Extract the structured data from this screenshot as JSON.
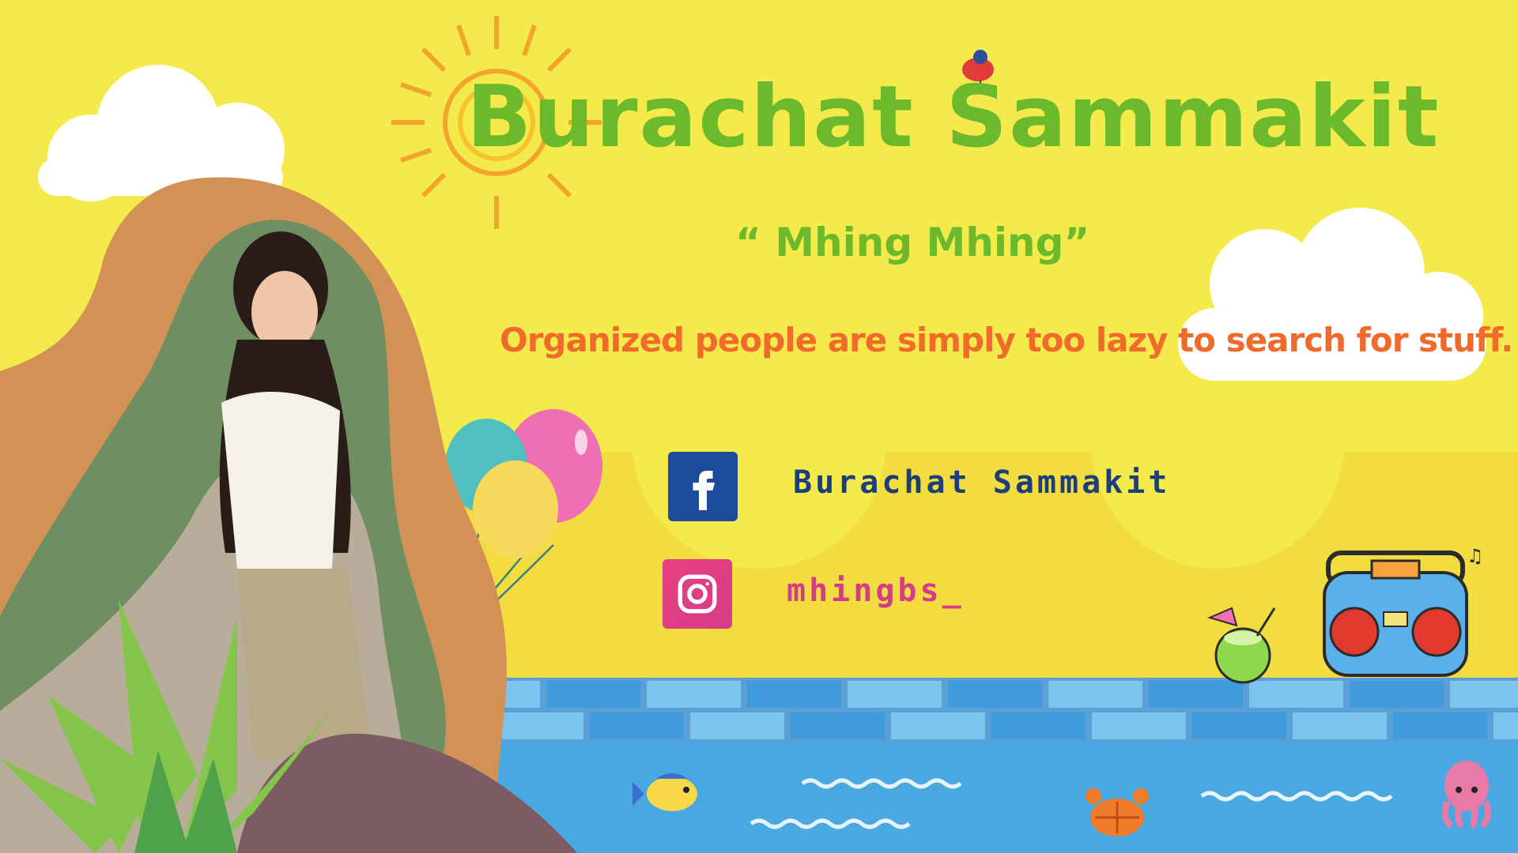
{
  "profile": {
    "name": "Burachat Sammakit",
    "nickname": "“ Mhing Mhing”",
    "tagline": "Organized people are simply too lazy to search for stuff."
  },
  "social": {
    "facebook": {
      "icon": "facebook-icon",
      "handle": "Burachat Sammakit"
    },
    "instagram": {
      "icon": "instagram-icon",
      "handle": "mhingbs_"
    }
  },
  "colors": {
    "background": "#f5ea4c",
    "title": "#6cba2c",
    "tagline": "#ef6a2b",
    "facebook": "#1c4b9c",
    "instagram": "#d63b8a",
    "pool": "#4aa8e0"
  }
}
